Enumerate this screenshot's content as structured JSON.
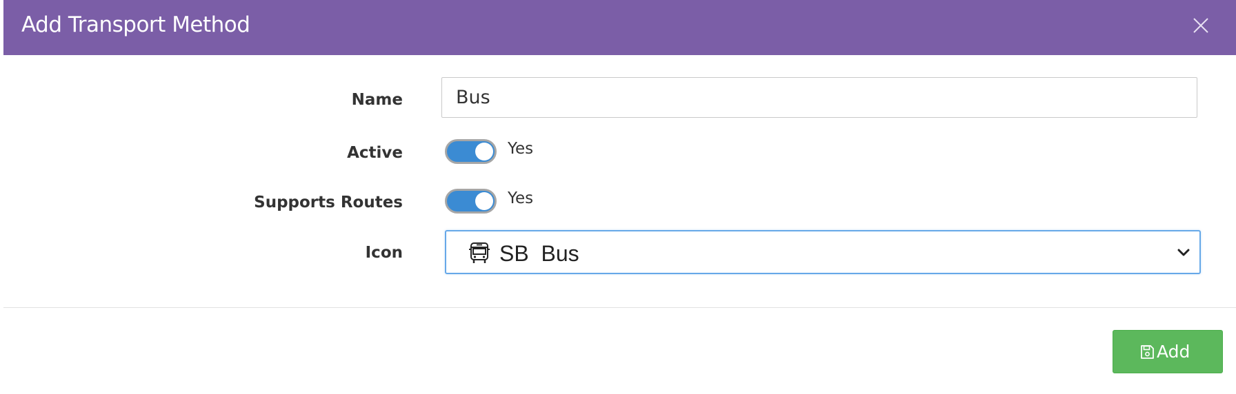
{
  "modal": {
    "title": "Add Transport Method",
    "close_icon": "close-icon"
  },
  "form": {
    "name": {
      "label": "Name",
      "value": "Bus"
    },
    "active": {
      "label": "Active",
      "state_text": "Yes",
      "checked": true
    },
    "supports_routes": {
      "label": "Supports Routes",
      "state_text": "Yes",
      "checked": true
    },
    "icon": {
      "label": "Icon",
      "selected_icon": "bus-icon",
      "selected_value": "SB  Bus"
    }
  },
  "footer": {
    "add_label": "Add",
    "add_icon": "save-icon"
  },
  "colors": {
    "header_bg": "#7b5ea7",
    "toggle_on": "#3b8bd3",
    "add_button": "#5cb85c",
    "select_focus_border": "#66a8e8"
  }
}
